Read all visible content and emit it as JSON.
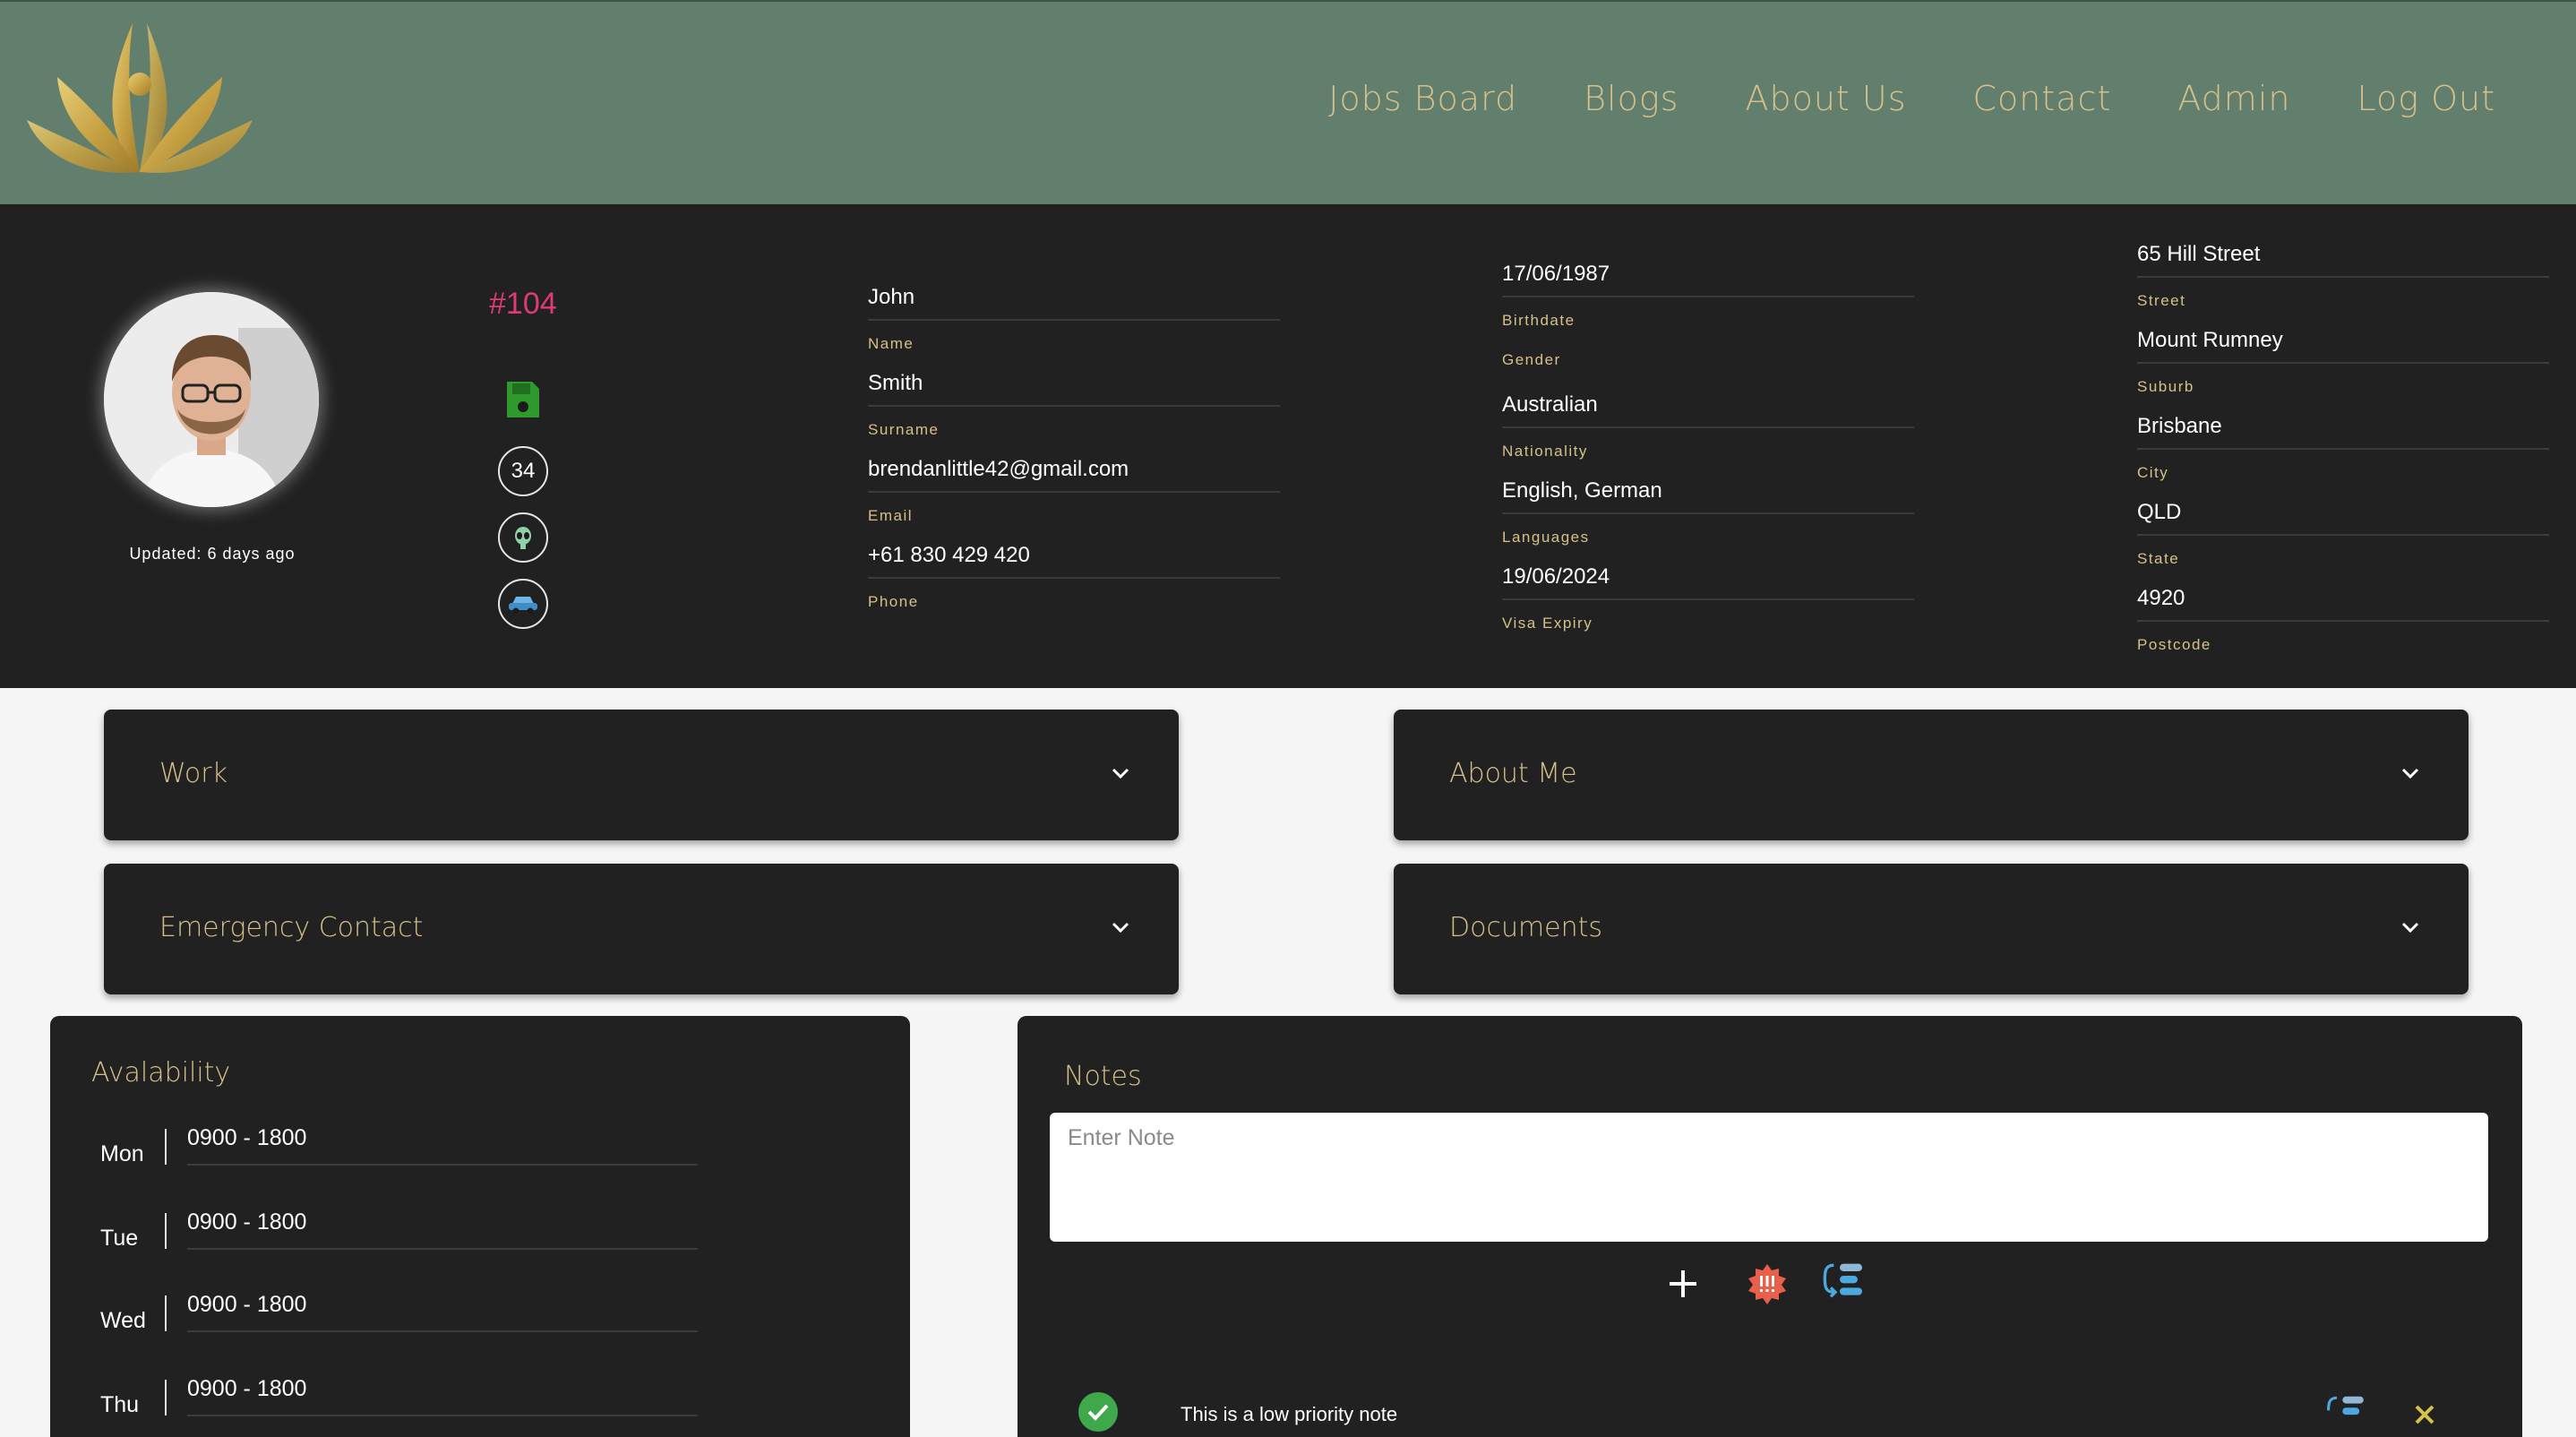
{
  "nav": {
    "items": [
      {
        "label": "Jobs Board"
      },
      {
        "label": "Blogs"
      },
      {
        "label": "About Us"
      },
      {
        "label": "Contact"
      },
      {
        "label": "Admin"
      },
      {
        "label": "Log Out"
      }
    ]
  },
  "profile": {
    "id": "#104",
    "updated": "Updated: 6 days ago",
    "badge_count": "34",
    "name": {
      "value": "John",
      "label": "Name"
    },
    "surname": {
      "value": "Smith",
      "label": "Surname"
    },
    "email": {
      "value": "brendanlittle42@gmail.com",
      "label": "Email"
    },
    "phone": {
      "value": "+61 830 429 420",
      "label": "Phone"
    },
    "birthdate": {
      "value": "17/06/1987",
      "label": "Birthdate"
    },
    "gender": {
      "label": "Gender"
    },
    "nationality": {
      "value": "Australian",
      "label": "Nationality"
    },
    "languages": {
      "value": "English, German",
      "label": "Languages"
    },
    "visa": {
      "value": "19/06/2024",
      "label": "Visa Expiry"
    },
    "street": {
      "value": "65 Hill Street",
      "label": "Street"
    },
    "suburb": {
      "value": "Mount Rumney",
      "label": "Suburb"
    },
    "city": {
      "value": "Brisbane",
      "label": "City"
    },
    "state": {
      "value": "QLD",
      "label": "State"
    },
    "postcode": {
      "value": "4920",
      "label": "Postcode"
    }
  },
  "sections": {
    "work": "Work",
    "about": "About Me",
    "emergency": "Emergency Contact",
    "documents": "Documents"
  },
  "availability": {
    "title": "Avalability",
    "days": [
      {
        "day": "Mon",
        "time": "0900 - 1800"
      },
      {
        "day": "Tue",
        "time": "0900 - 1800"
      },
      {
        "day": "Wed",
        "time": "0900 - 1800"
      },
      {
        "day": "Thu",
        "time": "0900 - 1800"
      }
    ]
  },
  "notes": {
    "title": "Notes",
    "placeholder": "Enter Note",
    "first_note": "This is a low priority note"
  },
  "colors": {
    "nav_bg": "#627f6d",
    "gold": "#d6c08a",
    "panel": "#212121",
    "accent_pink": "#e0397a",
    "save_green": "#2e9a2e"
  }
}
